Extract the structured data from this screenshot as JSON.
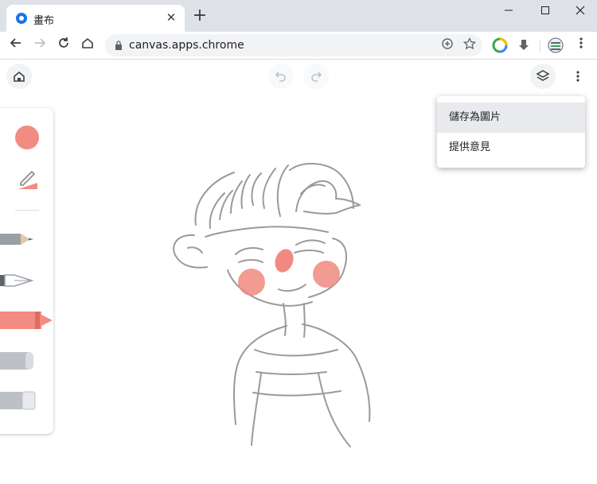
{
  "browser": {
    "tab_title": "畫布",
    "tab_close_glyph": "✕",
    "new_tab_glyph": "+",
    "window_buttons": [
      "—",
      "☐",
      "✕"
    ],
    "url": "canvas.apps.chrome"
  },
  "menu": {
    "items": [
      "儲存為圖片",
      "提供意見"
    ]
  },
  "toolbar": {
    "selected_color": "#f28b82"
  },
  "drawing": {
    "stroke_color": "#8f8f8f",
    "blush_color": "#f08a80"
  }
}
